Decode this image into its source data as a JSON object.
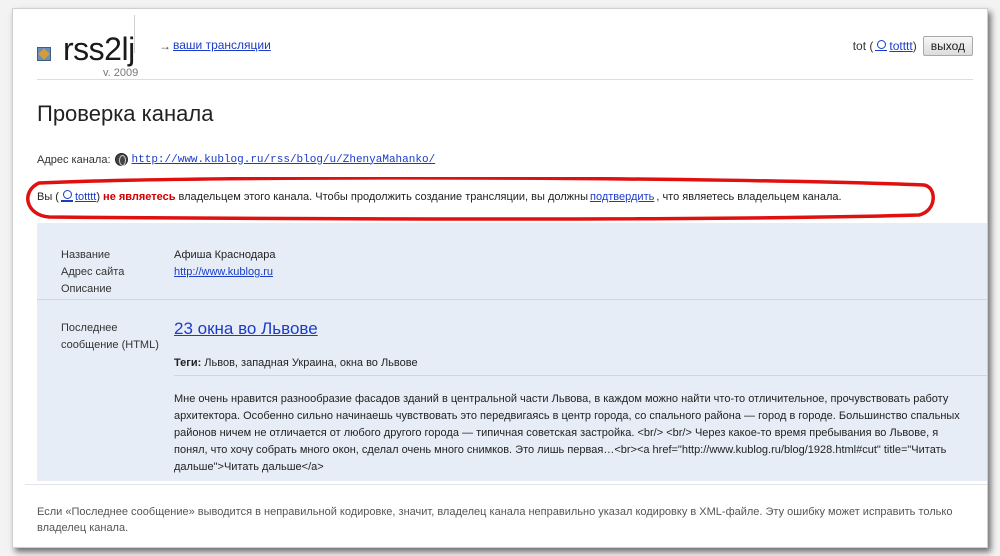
{
  "header": {
    "app_title": "rss2lj",
    "app_year": "v. 2009",
    "nav_arrow": "→",
    "nav_link": "ваши трансляции"
  },
  "user": {
    "prefix": "tot (",
    "username": "totttt",
    "suffix": ")",
    "logout_label": "выход"
  },
  "page": {
    "title": "Проверка канала"
  },
  "feed": {
    "label": "Адрес канала:",
    "url": "http://www.kublog.ru/rss/blog/u/ZhenyaMahanko/"
  },
  "warning": {
    "prefix": "Вы (",
    "username": "totttt",
    "suffix": ")",
    "strong": "не являетесь",
    "middle": "владельцем этого канала. Чтобы продолжить создание трансляции, вы должны",
    "link": "подтвердить",
    "end": ", что являетесь владельцем канала."
  },
  "info": {
    "labels": {
      "name": "Название",
      "site": "Адрес сайта",
      "description": "Описание",
      "last_post_1": "Последнее",
      "last_post_2": "сообщение (HTML)"
    },
    "name_value": "Афиша Краснодара",
    "site_value": "http://www.kublog.ru",
    "post": {
      "title": "23 окна во Львове",
      "tags_label": "Теги:",
      "tags_value": "Львов, западная Украина, окна во Львове",
      "body": "Мне очень нравится разнообразие фасадов зданий в центральной части Львова, в каждом можно найти что-то отличительное, прочувствовать работу архитектора. Особенно сильно начинаешь чувствовать это передвигаясь в центр города, со спального района — город в городе. Большинство спальных районов ничем не отличается от любого другого города — типичная советская застройка. <br/> <br/> Через какое-то время пребывания во Львове, я понял, что хочу собрать много окон, сделал очень много снимков. Это лишь первая…<br><a href=\"http://www.kublog.ru/blog/1928.html#cut\" title=\"Читать дальше\">Читать дальше</a>"
    }
  },
  "footer": {
    "note": "Если «Последнее сообщение» выводится в неправильной кодировке, значит, владелец канала неправильно указал кодировку в XML-файле. Эту ошибку может исправить только владелец канала."
  },
  "colors": {
    "link": "#1a3cc8",
    "warning_strong": "#cc0000",
    "panel_bg": "#e7edf6",
    "annotation_oval": "#e01010"
  },
  "icons": [
    "rss-logo-icon",
    "user-icon",
    "globe-icon"
  ]
}
